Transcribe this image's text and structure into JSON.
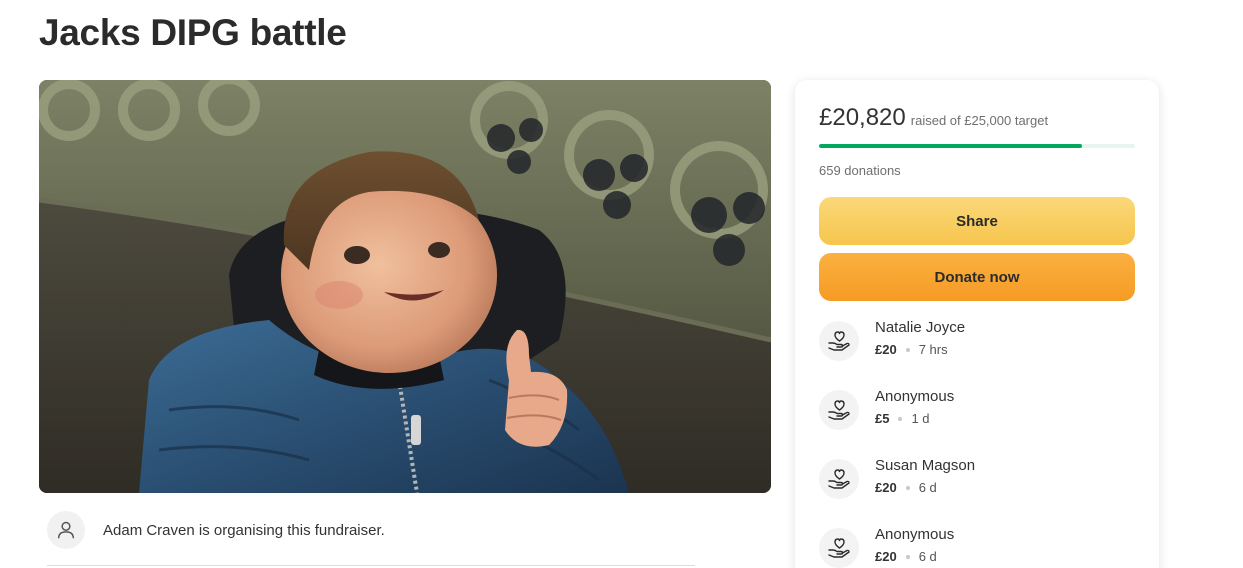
{
  "page": {
    "title": "Jacks DIPG battle"
  },
  "organiser": {
    "text": "Adam Craven is organising this fundraiser.",
    "avatar_icon": "user-icon"
  },
  "fundraiser": {
    "raised": "£20,820",
    "raised_suffix": "raised of £25,000 target",
    "progress_fraction": 0.8328,
    "donations_count": "659 donations",
    "share_label": "Share",
    "donate_label": "Donate now",
    "accent_color": "#02a95c"
  },
  "donors": [
    {
      "name": "Natalie Joyce",
      "amount": "£20",
      "time": "7 hrs",
      "icon": "heart-hand-icon"
    },
    {
      "name": "Anonymous",
      "amount": "£5",
      "time": "1 d",
      "icon": "heart-hand-icon"
    },
    {
      "name": "Susan Magson",
      "amount": "£20",
      "time": "6 d",
      "icon": "heart-hand-icon"
    },
    {
      "name": "Anonymous",
      "amount": "£20",
      "time": "6 d",
      "icon": "heart-hand-icon"
    }
  ]
}
